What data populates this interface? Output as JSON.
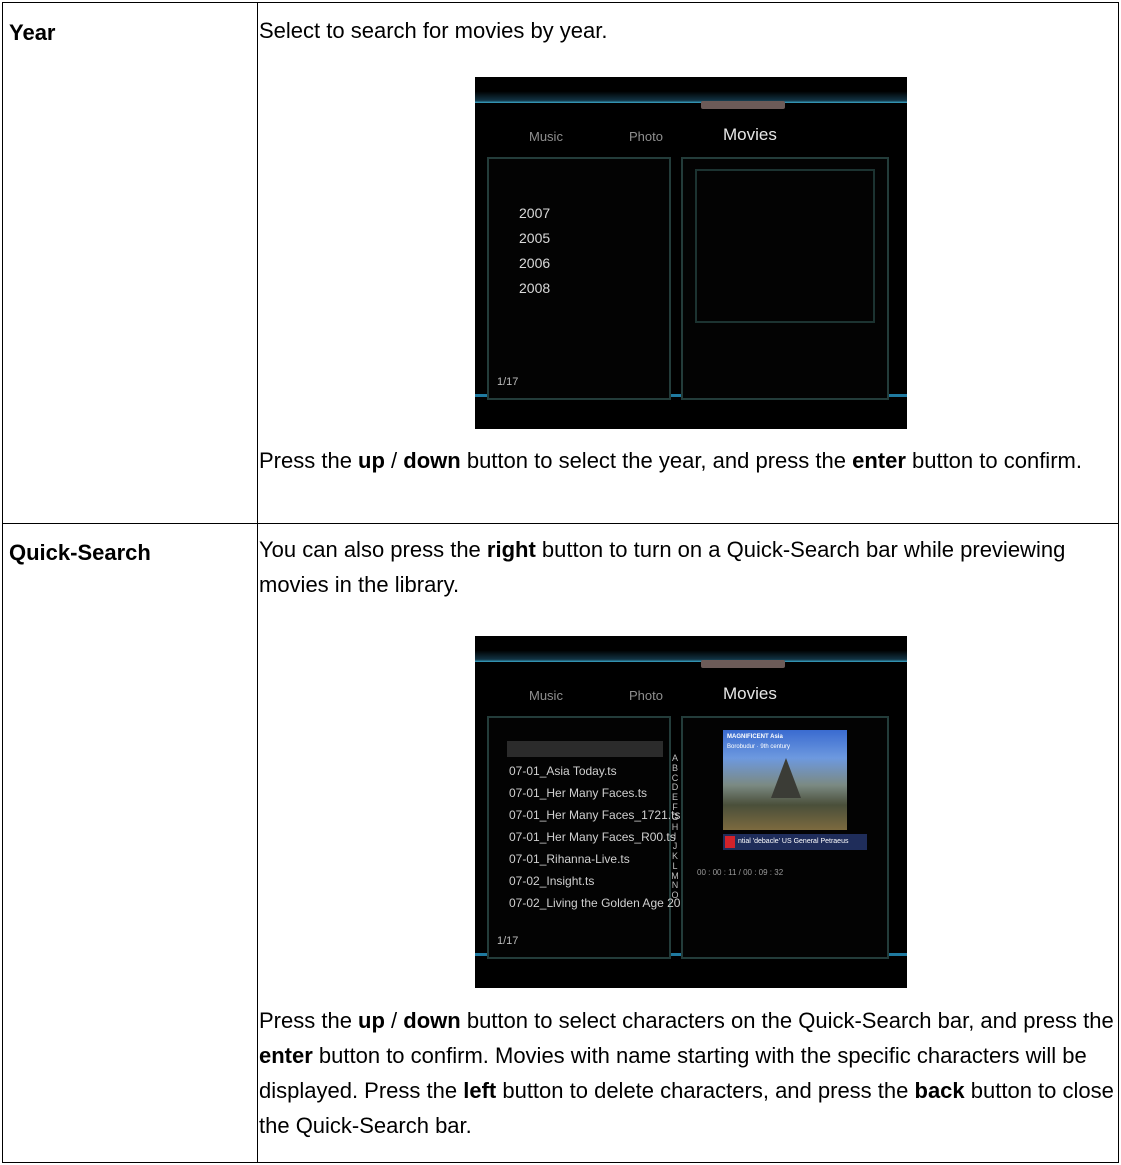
{
  "rows": [
    {
      "term": "Year",
      "intro": "Select to search for movies by year.",
      "instr": [
        "Press the ",
        "up",
        " / ",
        "down",
        " button to select the year, and press the ",
        "enter",
        " button to confirm."
      ]
    },
    {
      "term": "Quick-Search",
      "intro": [
        "You can also press the ",
        "right",
        " button to turn on a Quick-Search bar while previewing movies in the library."
      ],
      "instr": [
        "Press the ",
        "up",
        " / ",
        "down",
        " button to select characters on the Quick-Search bar, and press the ",
        "enter",
        " button to confirm. Movies with name starting with the specific characters will be displayed. Press the ",
        "left",
        " button to delete characters, and press the ",
        "back",
        " button to close the Quick-Search bar."
      ]
    }
  ],
  "screen_year": {
    "tabs": [
      "Music",
      "Photo",
      "Movies"
    ],
    "years": [
      "2007",
      "2005",
      "2006",
      "2008"
    ],
    "pager": "1/17"
  },
  "screen_quick": {
    "tabs": [
      "Music",
      "Photo",
      "Movies"
    ],
    "files": [
      "07-01_Asia Today.ts",
      "07-01_Her Many Faces.ts",
      "07-01_Her Many Faces_1721.ts",
      "07-01_Her Many Faces_R00.ts",
      "07-01_Rihanna-Live.ts",
      "07-02_Insight.ts",
      "07-02_Living the Golden Age 20"
    ],
    "letters": [
      "A",
      "B",
      "C",
      "D",
      "E",
      "F",
      "G",
      "H",
      "I",
      "J",
      "K",
      "L",
      "M",
      "N",
      "O"
    ],
    "pager": "1/17",
    "preview_logo": "MAGNIFICENT Asia",
    "preview_sub": "Borobudur · 9th century",
    "ticker": "ntial 'debacle'   US General Petraeus",
    "time": "00 : 00 : 11 / 00 : 09 : 32"
  }
}
